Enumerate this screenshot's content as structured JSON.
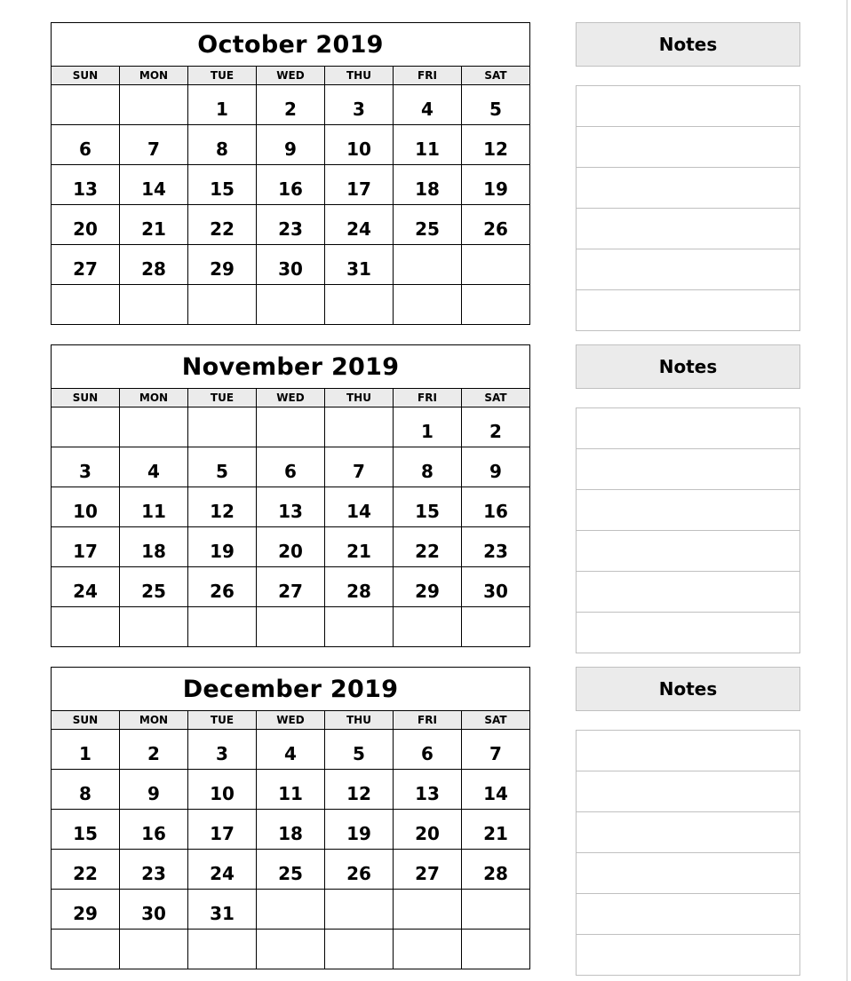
{
  "weekdays": [
    "SUN",
    "MON",
    "TUE",
    "WED",
    "THU",
    "FRI",
    "SAT"
  ],
  "notes_label": "Notes",
  "months": [
    {
      "title": "October 2019",
      "weeks": [
        [
          "",
          "",
          "1",
          "2",
          "3",
          "4",
          "5"
        ],
        [
          "6",
          "7",
          "8",
          "9",
          "10",
          "11",
          "12"
        ],
        [
          "13",
          "14",
          "15",
          "16",
          "17",
          "18",
          "19"
        ],
        [
          "20",
          "21",
          "22",
          "23",
          "24",
          "25",
          "26"
        ],
        [
          "27",
          "28",
          "29",
          "30",
          "31",
          "",
          ""
        ],
        [
          "",
          "",
          "",
          "",
          "",
          "",
          ""
        ]
      ]
    },
    {
      "title": "November 2019",
      "weeks": [
        [
          "",
          "",
          "",
          "",
          "",
          "1",
          "2"
        ],
        [
          "3",
          "4",
          "5",
          "6",
          "7",
          "8",
          "9"
        ],
        [
          "10",
          "11",
          "12",
          "13",
          "14",
          "15",
          "16"
        ],
        [
          "17",
          "18",
          "19",
          "20",
          "21",
          "22",
          "23"
        ],
        [
          "24",
          "25",
          "26",
          "27",
          "28",
          "29",
          "30"
        ],
        [
          "",
          "",
          "",
          "",
          "",
          "",
          ""
        ]
      ]
    },
    {
      "title": "December 2019",
      "weeks": [
        [
          "1",
          "2",
          "3",
          "4",
          "5",
          "6",
          "7"
        ],
        [
          "8",
          "9",
          "10",
          "11",
          "12",
          "13",
          "14"
        ],
        [
          "15",
          "16",
          "17",
          "18",
          "19",
          "20",
          "21"
        ],
        [
          "22",
          "23",
          "24",
          "25",
          "26",
          "27",
          "28"
        ],
        [
          "29",
          "30",
          "31",
          "",
          "",
          "",
          ""
        ],
        [
          "",
          "",
          "",
          "",
          "",
          "",
          ""
        ]
      ]
    }
  ]
}
